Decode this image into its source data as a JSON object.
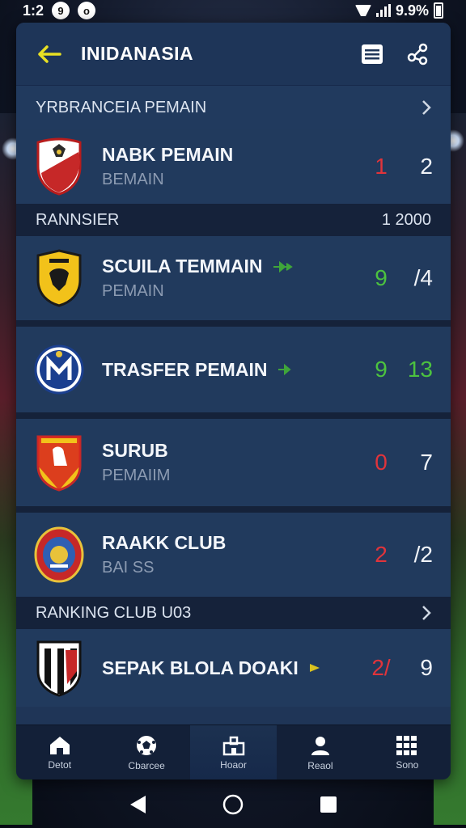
{
  "status": {
    "time": "1:2",
    "icon1": "9",
    "icon2": "o",
    "battery_text": "9.9%"
  },
  "header": {
    "title": "INIDANASIA",
    "back_icon": "arrow-left-icon",
    "list_icon": "list-icon",
    "share_icon": "share-icon"
  },
  "section_top": {
    "label": "YRBRANCEIA PEMAIN"
  },
  "clubs_a": [
    {
      "name": "NABK PEMAIN",
      "sub": "BEMAIN",
      "score": "1",
      "score_color": "#e0343b",
      "total": "2",
      "trend": ""
    }
  ],
  "section_mid": {
    "label": "RANNSIER",
    "value": "1 2000"
  },
  "clubs_b": [
    {
      "name": "SCUILA TEMMAIN",
      "sub": "PEMAIN",
      "score": "9",
      "score_color": "#4cc23f",
      "total": "/4",
      "total_color": "#f0f3f8",
      "trend": "up"
    },
    {
      "name": "TRASFER PEMAIN",
      "sub": "",
      "score": "9",
      "score_color": "#4cc23f",
      "total": "13",
      "total_color": "#4cc23f",
      "trend": "up"
    },
    {
      "name": "SURUB",
      "sub": "PEMAIIM",
      "score": "0",
      "score_color": "#e0343b",
      "total": "7",
      "total_color": "#f0f3f8",
      "trend": ""
    },
    {
      "name": "RAAKK CLUB",
      "sub": "BAI SS",
      "score": "2",
      "score_color": "#e0343b",
      "total": "/2",
      "total_color": "#f0f3f8",
      "trend": ""
    }
  ],
  "section_bottom": {
    "label": "RANKING CLUB U03"
  },
  "clubs_c": [
    {
      "name": "SEPAK BLOLA DOAKI",
      "sub": "",
      "score": "2/",
      "score_color": "#e0343b",
      "total": "9",
      "total_color": "#f0f3f8",
      "trend": "yellow"
    }
  ],
  "nav": [
    {
      "label": "Detot",
      "icon": "home-icon"
    },
    {
      "label": "Cbarcee",
      "icon": "soccer-ball-icon"
    },
    {
      "label": "Hoaor",
      "icon": "stadium-icon"
    },
    {
      "label": "Reaol",
      "icon": "user-icon"
    },
    {
      "label": "Sono",
      "icon": "grid-icon"
    }
  ],
  "colors": {
    "card": "#1f3557",
    "accent_yellow": "#e8e023",
    "red": "#e0343b",
    "green": "#4cc23f"
  }
}
